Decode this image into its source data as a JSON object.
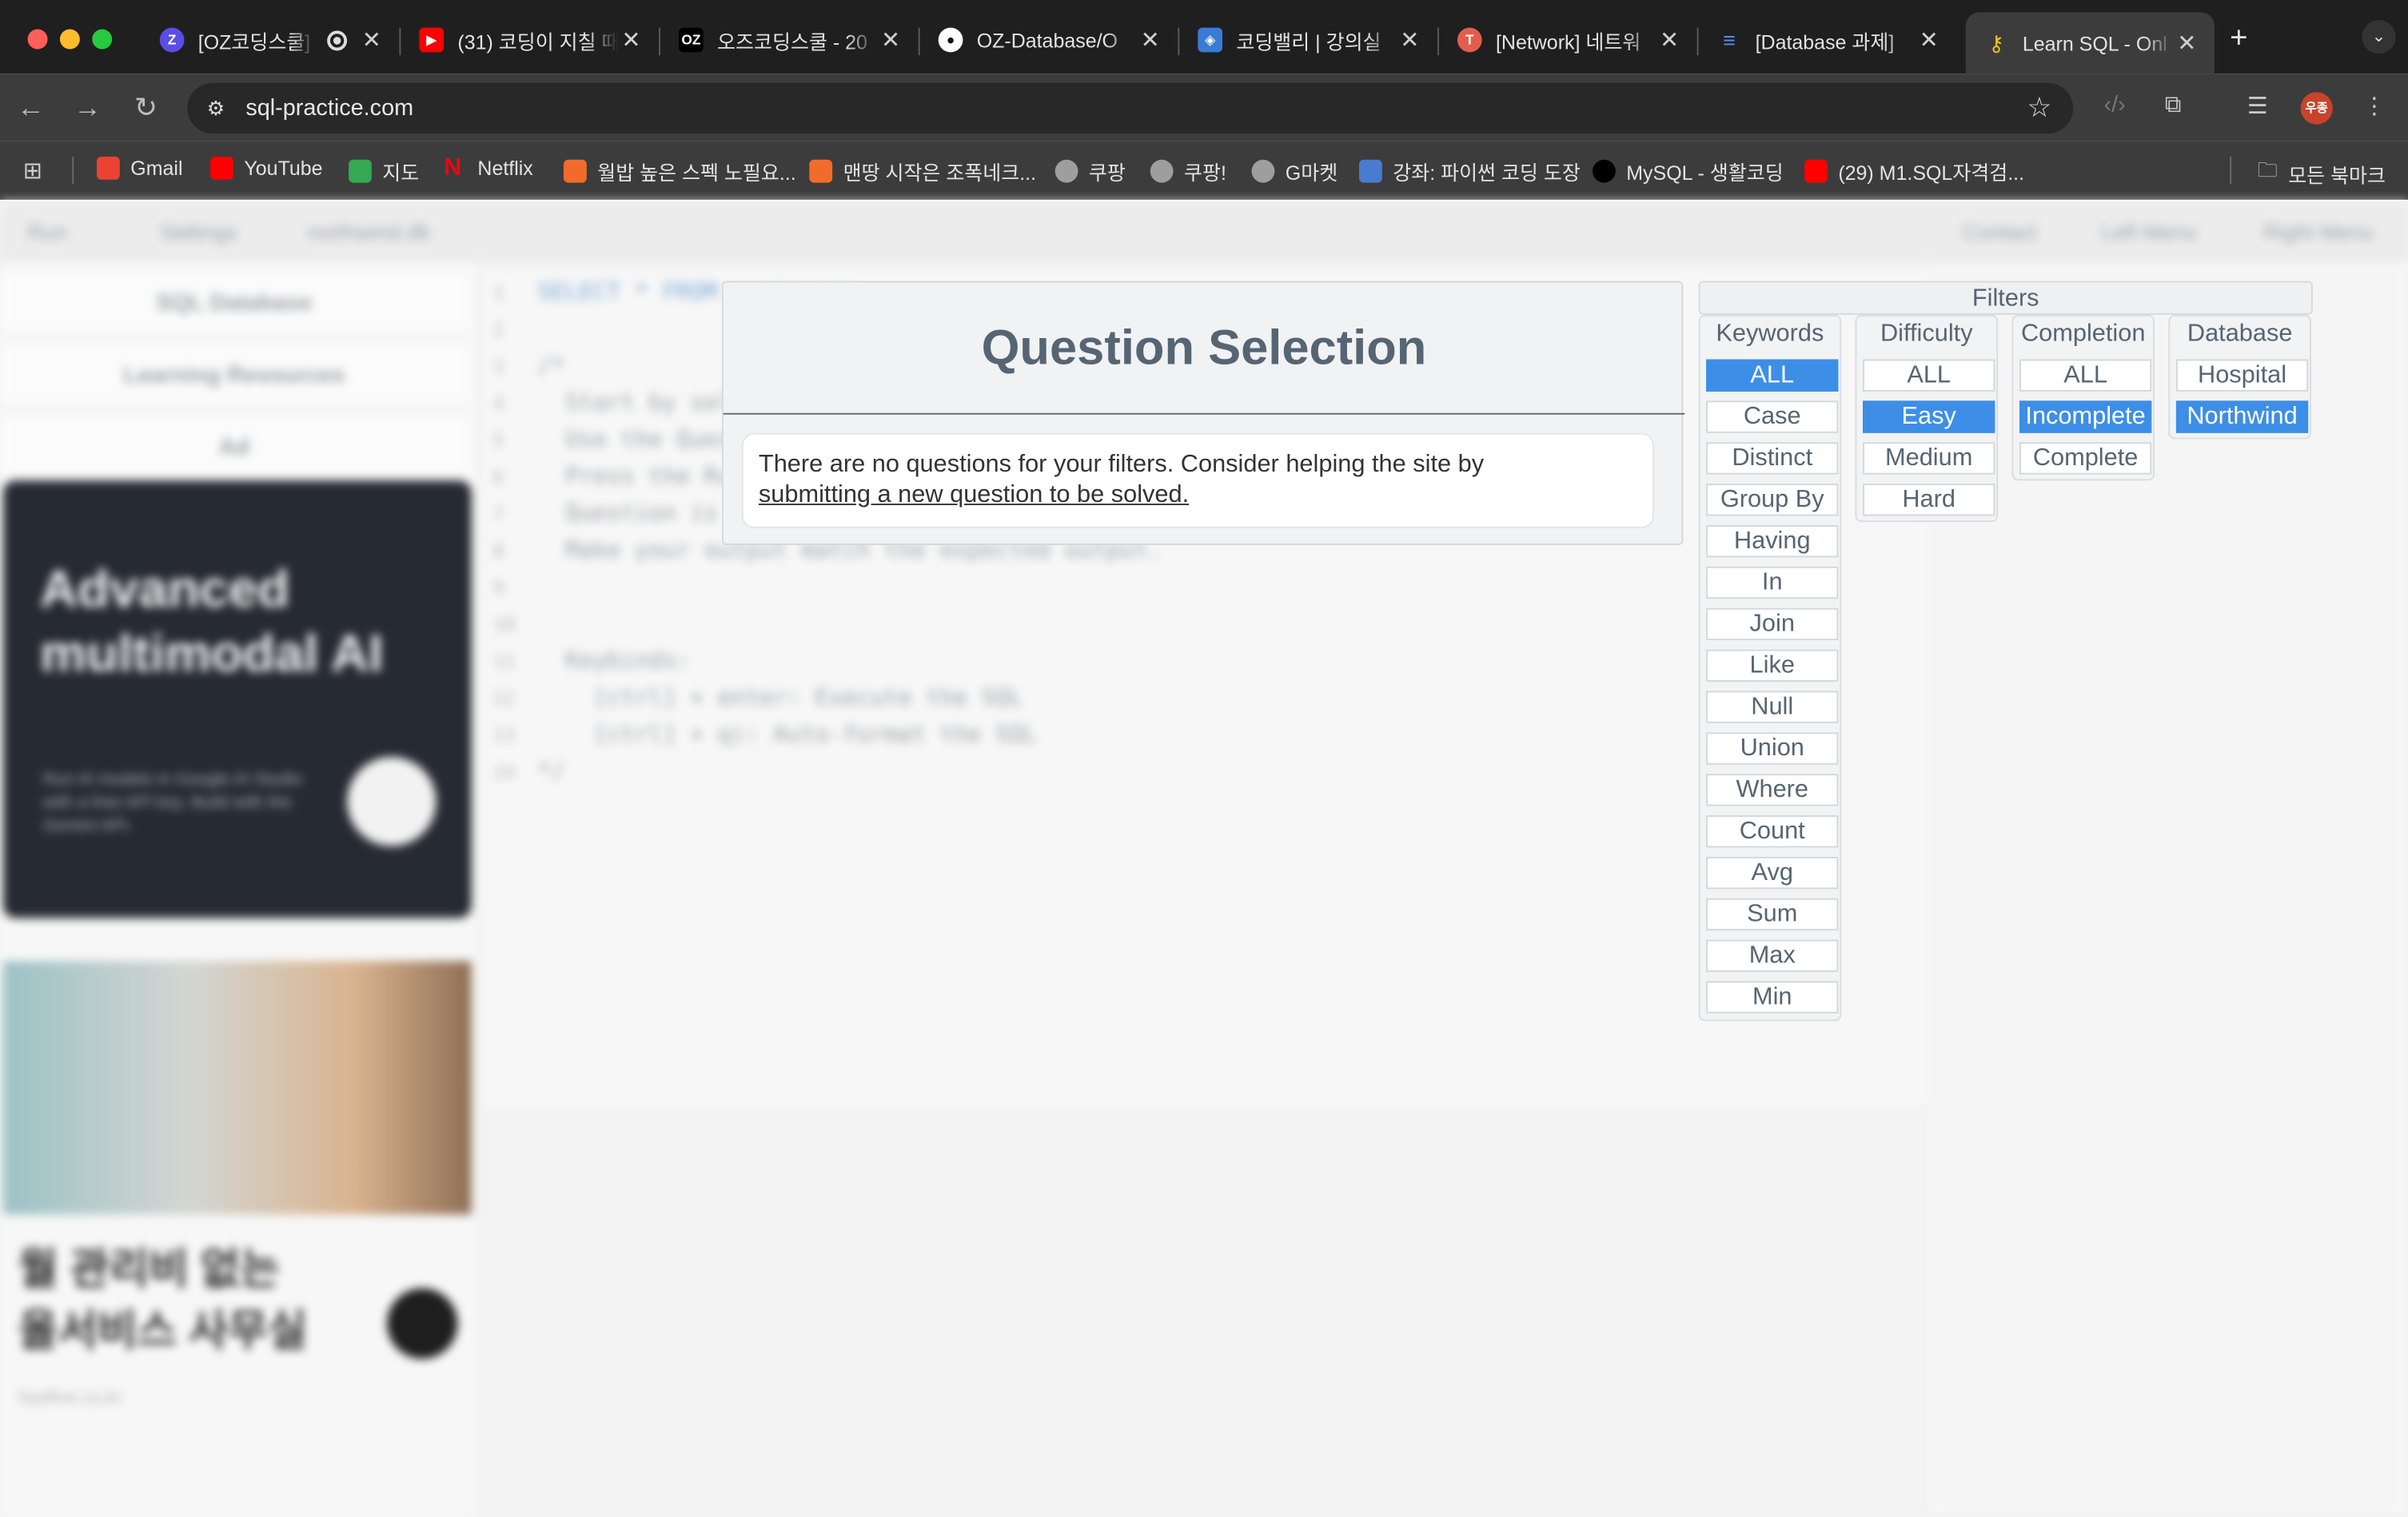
{
  "browser": {
    "tabs": [
      {
        "title": "[OZ코딩스쿨]",
        "icon": "zep-icon",
        "color": "#5b4ee6",
        "recording": true
      },
      {
        "title": "(31) 코딩이 지칠 때",
        "icon": "youtube-icon",
        "color": "#ff0000"
      },
      {
        "title": "오즈코딩스쿨 - 20",
        "icon": "oz-icon",
        "color": "#000000"
      },
      {
        "title": "OZ-Database/O",
        "icon": "github-icon",
        "color": "#ffffff"
      },
      {
        "title": "코딩밸리 | 강의실",
        "icon": "codingvalley-icon",
        "color": "#3a7bd5"
      },
      {
        "title": "[Network] 네트워",
        "icon": "velog-icon",
        "color": "#e35d4f"
      },
      {
        "title": "[Database 과제]",
        "icon": "database-icon",
        "color": "#5a8ee8"
      },
      {
        "title": "Learn SQL - Onl",
        "icon": "key-icon",
        "color": "#f0c419",
        "active": true
      }
    ],
    "new_tab": "+",
    "url": "sql-practice.com",
    "bookmarks": [
      {
        "label": "Gmail",
        "color": "#ea4335"
      },
      {
        "label": "YouTube",
        "color": "#ff0000"
      },
      {
        "label": "지도",
        "color": "#34a853"
      },
      {
        "label": "Netflix",
        "color": "#e50914"
      },
      {
        "label": "월밥 높은 스펙 노필요...",
        "color": "#f26b2b"
      },
      {
        "label": "맨땅 시작은 조폭네크...",
        "color": "#f26b2b"
      },
      {
        "label": "쿠팡",
        "color": "#9e9e9e"
      },
      {
        "label": "쿠팡!",
        "color": "#9e9e9e"
      },
      {
        "label": "G마켓",
        "color": "#9e9e9e"
      },
      {
        "label": "강좌: 파이썬 코딩 도장",
        "color": "#4a7bd0"
      },
      {
        "label": "MySQL - 생활코딩",
        "color": "#000000"
      },
      {
        "label": "(29) M1.SQL자격검...",
        "color": "#ff0000"
      }
    ],
    "all_bookmarks": "모든 북마크",
    "profile_initial": "우종"
  },
  "background": {
    "topbar": [
      "Run",
      "Settings",
      "northwind.db",
      "Contact",
      "Left Menu",
      "Right Menu"
    ],
    "sidebar": [
      "SQL Database",
      "Learning Resources",
      "Ad"
    ],
    "ad_headline": [
      "Advanced",
      "multimodal AI"
    ],
    "ad_small": "Run AI models in Google AI Studio with a free API key. Build with the Gemini API.",
    "ad2_headline": [
      "월 관리비 없는",
      "올서비스 사무실"
    ],
    "ad2_foot": "fastfive.co.kr",
    "editor_line_numbers": [
      "1",
      "2",
      "3",
      "4",
      "5",
      "6",
      "7",
      "8",
      "9",
      "10",
      "11",
      "12",
      "13",
      "14"
    ],
    "editor_lines": [
      "SELECT * FROM customers",
      "",
      "/*",
      "  Start by selecting a question",
      "  Use the Question Selection window",
      "  Press the Run button",
      "  Question is solved when",
      "  Make your output match the expected output.",
      "",
      "",
      "  Keybinds:",
      "    [ctrl] + enter: Execute the SQL",
      "    [ctrl] + q): Auto-format the SQL",
      "*/"
    ]
  },
  "question_selection": {
    "title": "Question Selection",
    "message": "There are no questions for your filters. Consider helping the site by",
    "link": "submitting a new question to be solved."
  },
  "filters": {
    "title": "Filters",
    "columns": [
      {
        "header": "Keywords",
        "options": [
          "ALL",
          "Case",
          "Distinct",
          "Group By",
          "Having",
          "In",
          "Join",
          "Like",
          "Null",
          "Union",
          "Where",
          "Count",
          "Avg",
          "Sum",
          "Max",
          "Min"
        ],
        "selected": "ALL"
      },
      {
        "header": "Difficulty",
        "options": [
          "ALL",
          "Easy",
          "Medium",
          "Hard"
        ],
        "selected": "Easy"
      },
      {
        "header": "Completion",
        "options": [
          "ALL",
          "Incomplete",
          "Complete"
        ],
        "selected": "Incomplete"
      },
      {
        "header": "Database",
        "options": [
          "Hospital",
          "Northwind"
        ],
        "selected": "Northwind"
      }
    ]
  }
}
